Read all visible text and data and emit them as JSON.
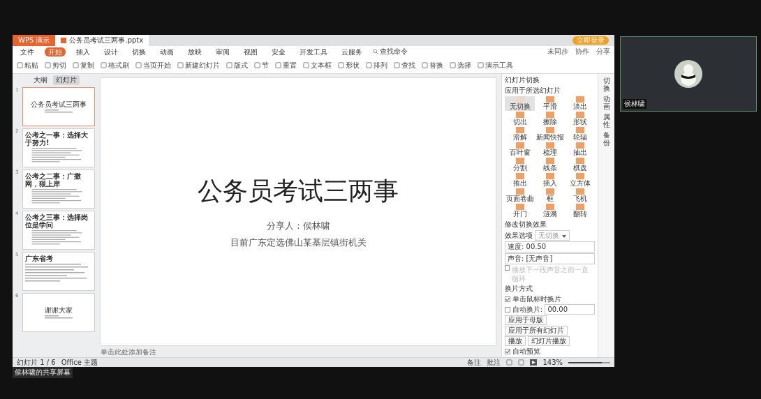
{
  "window": {
    "app_tab": "WPS 演示",
    "doc_tab": "公务员考试三两事.pptx",
    "login": "立即登录"
  },
  "menu": {
    "items": [
      {
        "label": "文件",
        "selected": false
      },
      {
        "label": "开始",
        "selected": true
      },
      {
        "label": "插入",
        "selected": false
      },
      {
        "label": "设计",
        "selected": false
      },
      {
        "label": "切换",
        "selected": false
      },
      {
        "label": "动画",
        "selected": false
      },
      {
        "label": "放映",
        "selected": false
      },
      {
        "label": "审阅",
        "selected": false
      },
      {
        "label": "视图",
        "selected": false
      },
      {
        "label": "安全",
        "selected": false
      },
      {
        "label": "开发工具",
        "selected": false
      },
      {
        "label": "云服务",
        "selected": false
      }
    ],
    "search": "查找命令",
    "right": [
      "未同步",
      "协作",
      "分享"
    ]
  },
  "toolbar": [
    "粘贴",
    "剪切",
    "复制",
    "格式刷",
    "当页开始",
    "新建幻灯片",
    "版式",
    "节",
    "重置",
    "文本框",
    "形状",
    "排列",
    "查找",
    "替换",
    "选择",
    "演示工具"
  ],
  "outline_tabs": [
    {
      "label": "大纲",
      "selected": false
    },
    {
      "label": "幻灯片",
      "selected": true
    }
  ],
  "slides": [
    {
      "number": "1",
      "kind": "title",
      "title": "公务员考试三两事",
      "selected": true
    },
    {
      "number": "2",
      "kind": "content",
      "title": "公考之一事：选择大于努力!",
      "selected": false
    },
    {
      "number": "3",
      "kind": "content",
      "title": "公考之二事：广撒网，狠上岸",
      "selected": false
    },
    {
      "number": "4",
      "kind": "content",
      "title": "公考之三事：选择岗位是学问",
      "selected": false
    },
    {
      "number": "5",
      "kind": "content",
      "title": "广东省考",
      "selected": false
    },
    {
      "number": "6",
      "kind": "title",
      "title": "谢谢大家",
      "selected": false
    }
  ],
  "current_slide": {
    "title": "公务员考试三两事",
    "lines": [
      "分享人：侯林啸",
      "目前广东定选佛山某基层镇街机关"
    ]
  },
  "notes_placeholder": "单击此处添加备注",
  "transition_pane": {
    "title": "幻灯片切换",
    "subtitle": "应用于所选幻灯片",
    "effects": [
      {
        "label": "无切换",
        "selected": true
      },
      {
        "label": "平滑",
        "selected": false
      },
      {
        "label": "淡出",
        "selected": false
      },
      {
        "label": "切出",
        "selected": false
      },
      {
        "label": "擦除",
        "selected": false
      },
      {
        "label": "形状",
        "selected": false
      },
      {
        "label": "溶解",
        "selected": false
      },
      {
        "label": "新闻快报",
        "selected": false
      },
      {
        "label": "轮辐",
        "selected": false
      },
      {
        "label": "百叶窗",
        "selected": false
      },
      {
        "label": "梳理",
        "selected": false
      },
      {
        "label": "抽出",
        "selected": false
      },
      {
        "label": "分割",
        "selected": false
      },
      {
        "label": "线条",
        "selected": false
      },
      {
        "label": "棋盘",
        "selected": false
      },
      {
        "label": "推出",
        "selected": false
      },
      {
        "label": "插入",
        "selected": false
      },
      {
        "label": "立方体",
        "selected": false
      },
      {
        "label": "页面卷曲",
        "selected": false
      },
      {
        "label": "框",
        "selected": false
      },
      {
        "label": "飞机",
        "selected": false
      },
      {
        "label": "开门",
        "selected": false
      },
      {
        "label": "涟漪",
        "selected": false
      },
      {
        "label": "翻转",
        "selected": false
      }
    ],
    "modify_title": "修改切换效果",
    "effect_label": "效果选项",
    "effect_value": "无切换",
    "speed": "速度: 00.50",
    "sound": "声音: [无声音]",
    "loop": {
      "label": "播放下一段声音之前一直循环",
      "checked": false,
      "disabled": true
    },
    "advance_title": "换片方式",
    "on_click": {
      "label": "单击鼠标时换片",
      "checked": true
    },
    "auto": {
      "label": "自动换片:",
      "value": "00.00",
      "checked": false
    },
    "apply_master": "应用于母版",
    "apply_all": "应用于所有幻灯片",
    "play": "播放",
    "slideshow": "幻灯片播放",
    "preview": {
      "label": "自动预览",
      "checked": true
    }
  },
  "side_strip": [
    "切换",
    "动画",
    "属性",
    "备份"
  ],
  "status": {
    "slide": "幻灯片 1 / 6",
    "theme": "Office 主题",
    "notes": "备注",
    "comments": "批注",
    "zoom": "143%",
    "zoom_slider": {
      "level": 0.8
    }
  },
  "video_tile": {
    "name": "侯林啸"
  },
  "share_label": "侯林啸的共享屏幕"
}
